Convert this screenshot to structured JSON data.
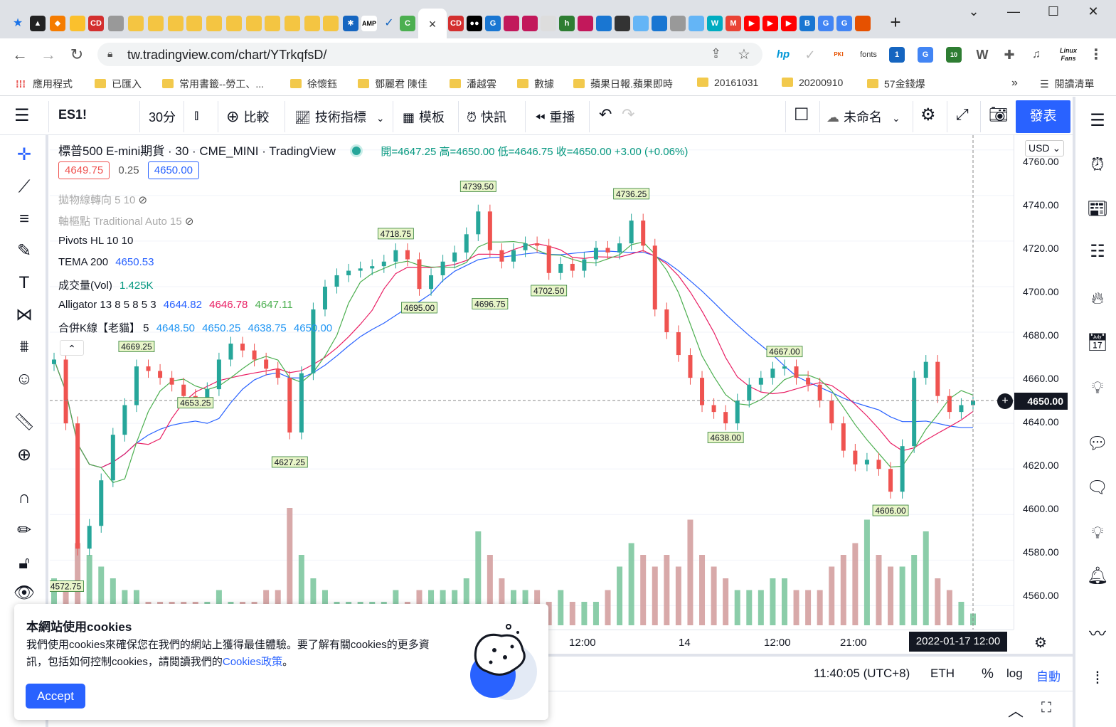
{
  "browser": {
    "active_tab_close": "×",
    "new_tab": "+",
    "url": "tw.tradingview.com/chart/YTrkqfsD/",
    "bookmarks": [
      "應用程式",
      "已匯入",
      "常用書籤--勞工、...",
      "徐懷鈺",
      "鄧麗君 陳佳",
      "潘越雲",
      "數據",
      "蘋果日報.蘋果即時",
      "20161031",
      "20200910",
      "57金錢爆"
    ],
    "reading_list": "閱讀清單",
    "ext_fonts": "fonts",
    "ext_linux": "Linux Fans",
    "ext_badge_1": "1",
    "ext_badge_10": "10"
  },
  "toolbar": {
    "symbol": "ES1!",
    "interval": "30分",
    "compare": "比較",
    "indicators": "技術指標",
    "templates": "模板",
    "alert": "快訊",
    "replay": "重播",
    "layout_name": "未命名",
    "publish": "發表"
  },
  "legend": {
    "title": "標普500 E-mini期貨 · 30 · CME_MINI · TradingView",
    "ohlc": "開=4647.25 高=4650.00 低=4646.75 收=4650.00 +3.00 (+0.06%)",
    "bid": "4649.75",
    "spread": "0.25",
    "ask": "4650.00",
    "ind_sar": "拋物線轉向 5 10",
    "ind_pivot": "軸樞點 Traditional Auto 15",
    "ind_pivots_hl": "Pivots HL 10 10",
    "ind_tema_name": "TEMA 200",
    "ind_tema_val": "4650.53",
    "ind_vol_name": "成交量(Vol)",
    "ind_vol_val": "1.425K",
    "ind_alligator_name": "Alligator 13 8 5 8 5 3",
    "ind_alligator_v1": "4644.82",
    "ind_alligator_v2": "4646.78",
    "ind_alligator_v3": "4647.11",
    "ind_merge_name": "合併K線【老貓】 5",
    "ind_merge_v1": "4648.50",
    "ind_merge_v2": "4650.25",
    "ind_merge_v3": "4638.75",
    "ind_merge_v4": "4650.00"
  },
  "price_scale": {
    "currency": "USD",
    "current": "4650.00",
    "ticks": [
      "4760.00",
      "4740.00",
      "4720.00",
      "4700.00",
      "4680.00",
      "4660.00",
      "4640.00",
      "4620.00",
      "4600.00",
      "4580.00",
      "4560.00"
    ]
  },
  "time_scale": {
    "labels": [
      "12:00",
      "14",
      "12:00",
      "21:00"
    ],
    "crosshair_date": "2022-01-17  12:00"
  },
  "status": {
    "clock": "11:40:05 (UTC+8)",
    "session": "ETH",
    "percent": "%",
    "log": "log",
    "auto": "自動"
  },
  "cookie": {
    "title": "本網站使用cookies",
    "text": "我們使用cookies來確保您在我們的網站上獲得最佳體驗。要了解有關cookies的更多資訊，包括如何控制cookies，請閱讀我們的",
    "link": "Cookies政策",
    "period": "。",
    "accept": "Accept"
  },
  "colors": {
    "up": "#26a69a",
    "down": "#ef5350",
    "accent": "#2962ff",
    "alligator_jaw": "#2962ff",
    "alligator_teeth": "#e91e63",
    "alligator_lips": "#4caf50"
  },
  "chart_data": {
    "type": "candlestick",
    "ylim": [
      4552,
      4764
    ],
    "pivot_labels": [
      {
        "i": 1,
        "v": 4572.75,
        "label": "4572.75",
        "pos": "low"
      },
      {
        "i": 7,
        "v": 4669.25,
        "label": "4669.25",
        "pos": "high"
      },
      {
        "i": 12,
        "v": 4653.25,
        "label": "4653.25",
        "pos": "low"
      },
      {
        "i": 20,
        "v": 4627.25,
        "label": "4627.25",
        "pos": "low"
      },
      {
        "i": 29,
        "v": 4718.75,
        "label": "4718.75",
        "pos": "high"
      },
      {
        "i": 31,
        "v": 4695.0,
        "label": "4695.00",
        "pos": "low"
      },
      {
        "i": 36,
        "v": 4739.5,
        "label": "4739.50",
        "pos": "high"
      },
      {
        "i": 37,
        "v": 4696.75,
        "label": "4696.75",
        "pos": "low"
      },
      {
        "i": 42,
        "v": 4702.5,
        "label": "4702.50",
        "pos": "low"
      },
      {
        "i": 49,
        "v": 4736.25,
        "label": "4736.25",
        "pos": "high"
      },
      {
        "i": 57,
        "v": 4638.0,
        "label": "4638.00",
        "pos": "low"
      },
      {
        "i": 62,
        "v": 4667.0,
        "label": "4667.00",
        "pos": "high"
      },
      {
        "i": 71,
        "v": 4606.0,
        "label": "4606.00",
        "pos": "low"
      }
    ],
    "close": [
      4668,
      4640,
      4585,
      4595,
      4615,
      4635,
      4648,
      4665,
      4663,
      4660,
      4657,
      4652,
      4650,
      4655,
      4668,
      4675,
      4672,
      4668,
      4664,
      4660,
      4636,
      4662,
      4690,
      4700,
      4705,
      4707,
      4708,
      4709,
      4711,
      4716,
      4712,
      4699,
      4705,
      4711,
      4715,
      4723,
      4733,
      4716,
      4711,
      4716,
      4719,
      4718,
      4706,
      4710,
      4707,
      4712,
      4717,
      4715,
      4719,
      4729,
      4718,
      4690,
      4680,
      4670,
      4660,
      4648,
      4645,
      4640,
      4650,
      4657,
      4660,
      4664,
      4665,
      4660,
      4657,
      4650,
      4640,
      4628,
      4622,
      4624,
      4620,
      4610,
      4630,
      4660,
      4667,
      4652,
      4645,
      4648,
      4650
    ],
    "volume": [
      0.4,
      0.3,
      0.7,
      0.6,
      0.5,
      0.4,
      0.3,
      0.3,
      0.2,
      0.2,
      0.2,
      0.2,
      0.2,
      0.2,
      0.3,
      0.2,
      0.2,
      0.2,
      0.3,
      0.3,
      1.0,
      0.6,
      0.4,
      0.3,
      0.2,
      0.2,
      0.2,
      0.2,
      0.2,
      0.3,
      0.2,
      0.3,
      0.3,
      0.3,
      0.3,
      0.4,
      0.8,
      0.6,
      0.4,
      0.3,
      0.3,
      0.3,
      0.2,
      0.3,
      0.2,
      0.2,
      0.2,
      0.3,
      0.5,
      0.7,
      0.6,
      0.5,
      0.6,
      0.5,
      0.9,
      0.6,
      0.5,
      0.4,
      0.3,
      0.3,
      0.3,
      0.4,
      0.4,
      0.3,
      0.3,
      0.3,
      0.5,
      0.6,
      0.7,
      0.9,
      0.6,
      0.5,
      0.5,
      0.6,
      0.8,
      0.4,
      0.3,
      0.2,
      0.1
    ]
  }
}
